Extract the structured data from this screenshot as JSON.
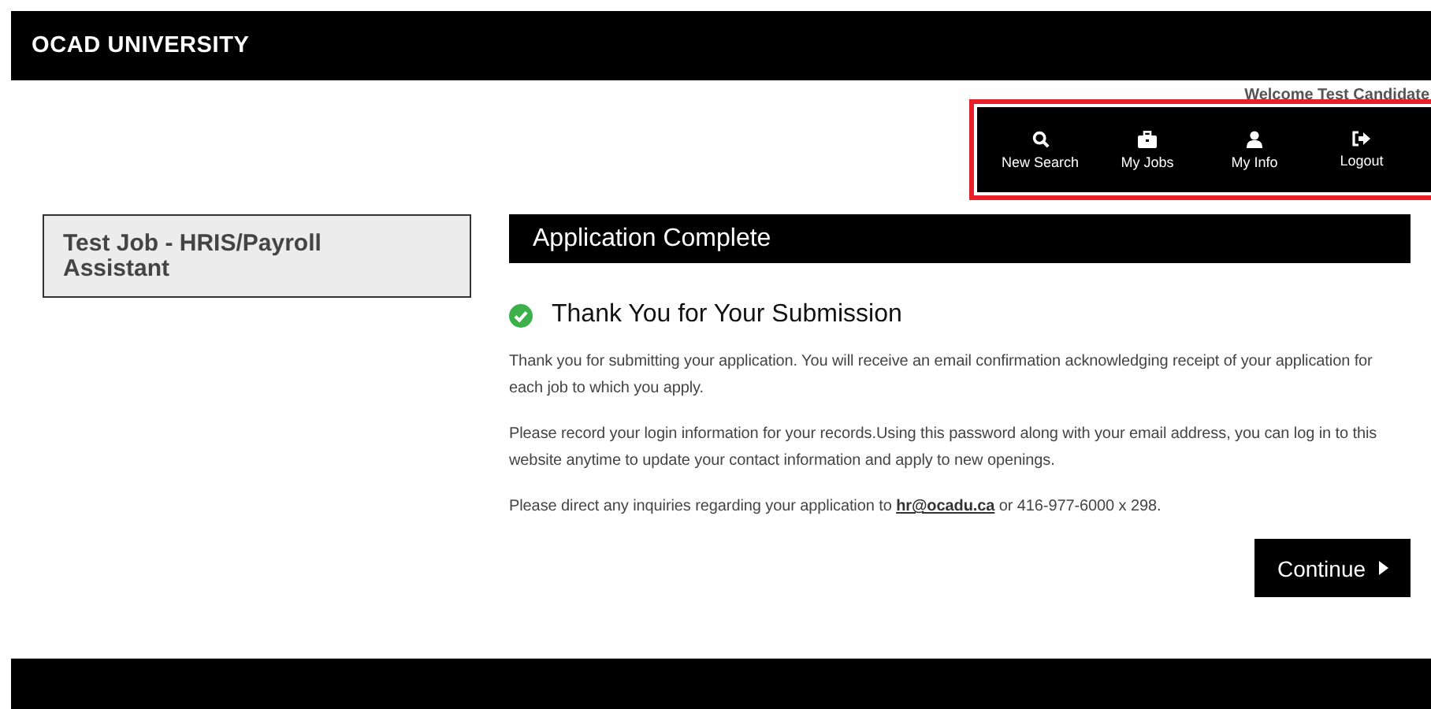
{
  "header": {
    "logo": "OCAD UNIVERSITY"
  },
  "welcome": "Welcome Test Candidate",
  "nav": [
    {
      "label": "New Search",
      "kind": "search"
    },
    {
      "label": "My Jobs",
      "kind": "jobs"
    },
    {
      "label": "My Info",
      "kind": "user"
    },
    {
      "label": "Logout",
      "kind": "logout"
    }
  ],
  "job_title": "Test Job - HRIS/Payroll Assistant",
  "panel": {
    "title": "Application Complete",
    "heading": "Thank You for Your Submission",
    "paragraphs": [
      "Thank you for submitting your application.  You will receive an email confirmation acknowledging receipt of your application for each job to which you apply.",
      "Please record your login information for your records.Using this password along with your email address, you can log in to this website anytime to update your contact information and apply to new openings."
    ],
    "contact": {
      "before": "Please direct any inquiries regarding your application to",
      "link": "hr@ocadu.ca",
      "after": "or 416-977-6000 x 298."
    },
    "button": "Continue"
  }
}
